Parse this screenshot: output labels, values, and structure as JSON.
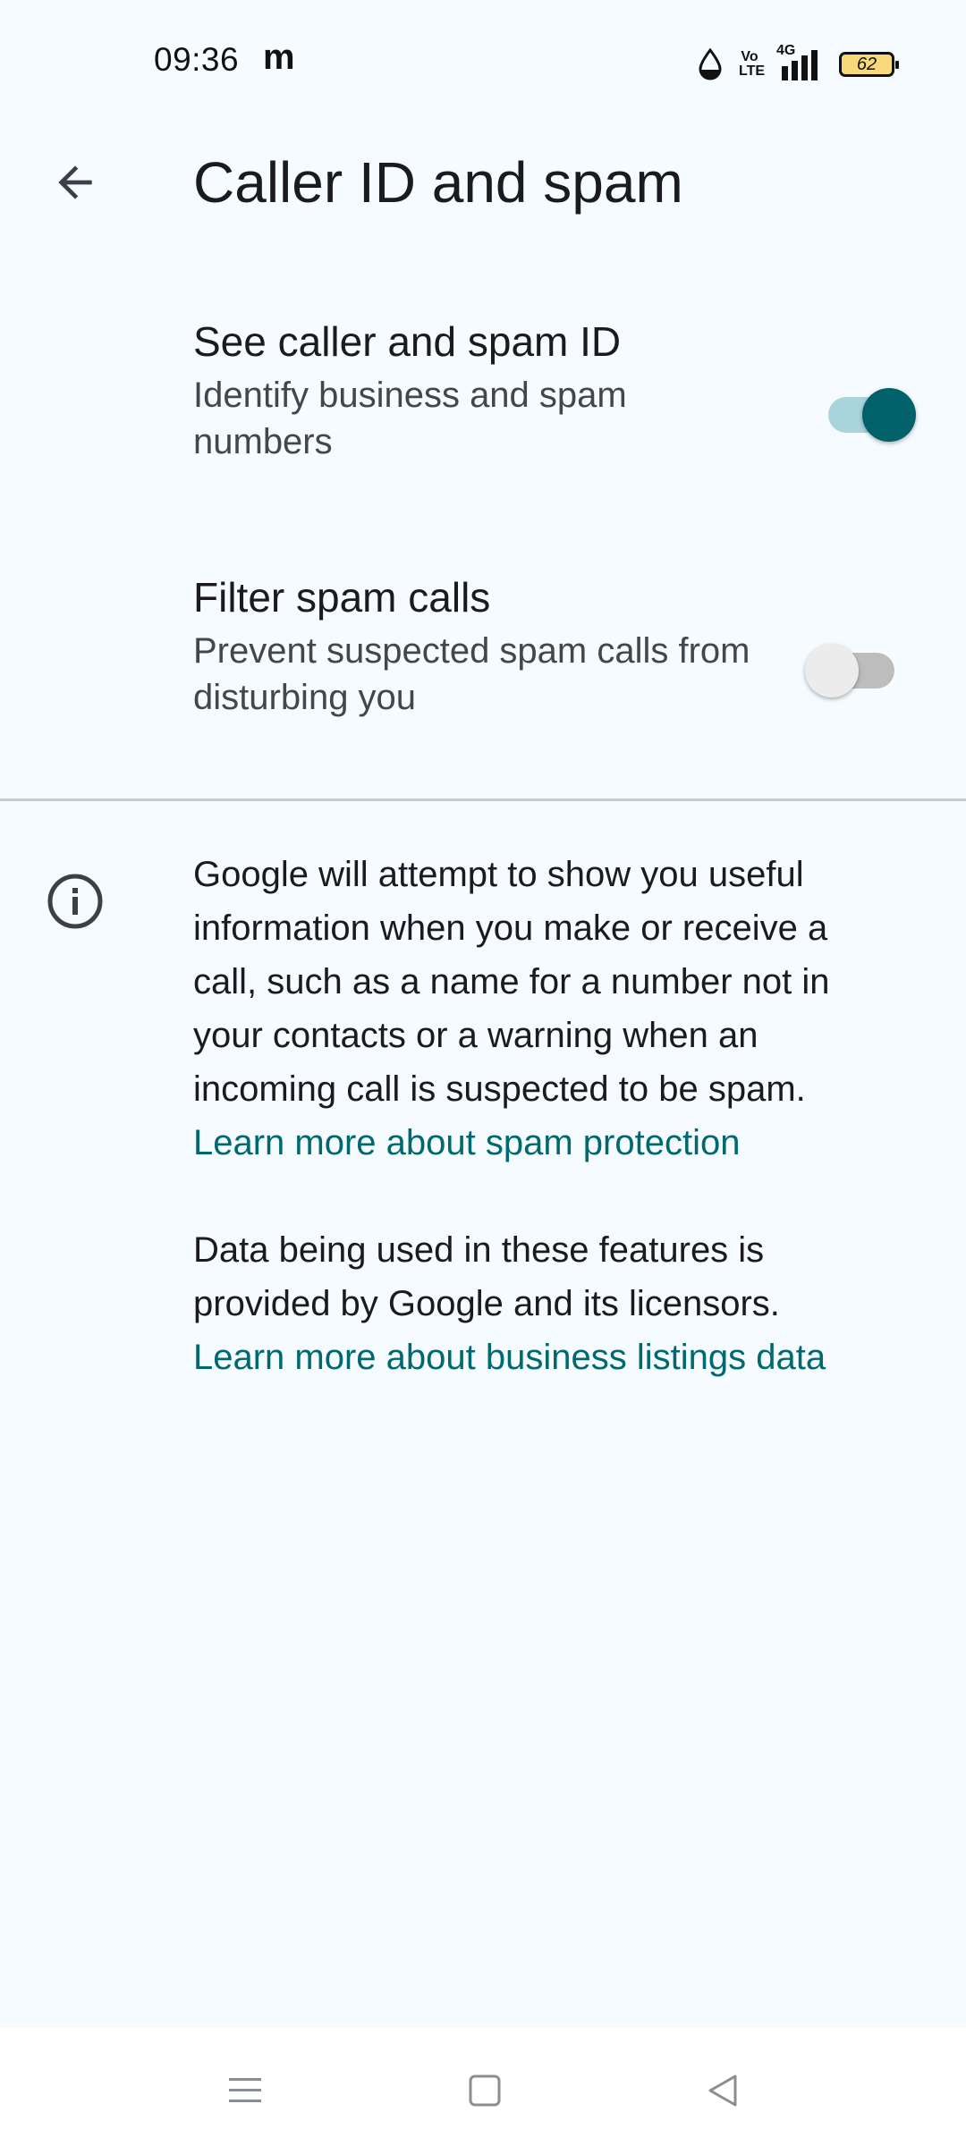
{
  "status_bar": {
    "time": "09:36",
    "app_indicator": "m",
    "volte_line1": "Vo",
    "volte_line2": "LTE",
    "network": "4G",
    "battery": "62",
    "icons": [
      "data-saver-drop-icon",
      "volte-icon",
      "signal-icon",
      "battery-icon"
    ]
  },
  "header": {
    "back_icon": "arrow-left-icon",
    "title": "Caller ID and spam"
  },
  "settings": [
    {
      "title": "See caller and spam ID",
      "summary": "Identify business and spam numbers",
      "enabled": true
    },
    {
      "title": "Filter spam calls",
      "summary": "Prevent suspected spam calls from disturbing you",
      "enabled": false
    }
  ],
  "info": {
    "icon": "info-icon",
    "paragraph1": "Google will attempt to show you useful information when you make or receive a call, such as a name for a number not in your contacts or a warning when an incoming call is suspected to be spam.",
    "link1": "Learn more about spam protection",
    "paragraph2": "Data being used in these features is provided by Google and its licensors.",
    "link2": "Learn more about business listings data"
  },
  "nav_bar": {
    "icons": [
      "menu-icon",
      "home-square-icon",
      "back-triangle-icon"
    ]
  },
  "colors": {
    "background": "#F5FBFE",
    "accent": "#00616B",
    "link": "#00696F",
    "switch_on_track": "#A8D5DB"
  }
}
